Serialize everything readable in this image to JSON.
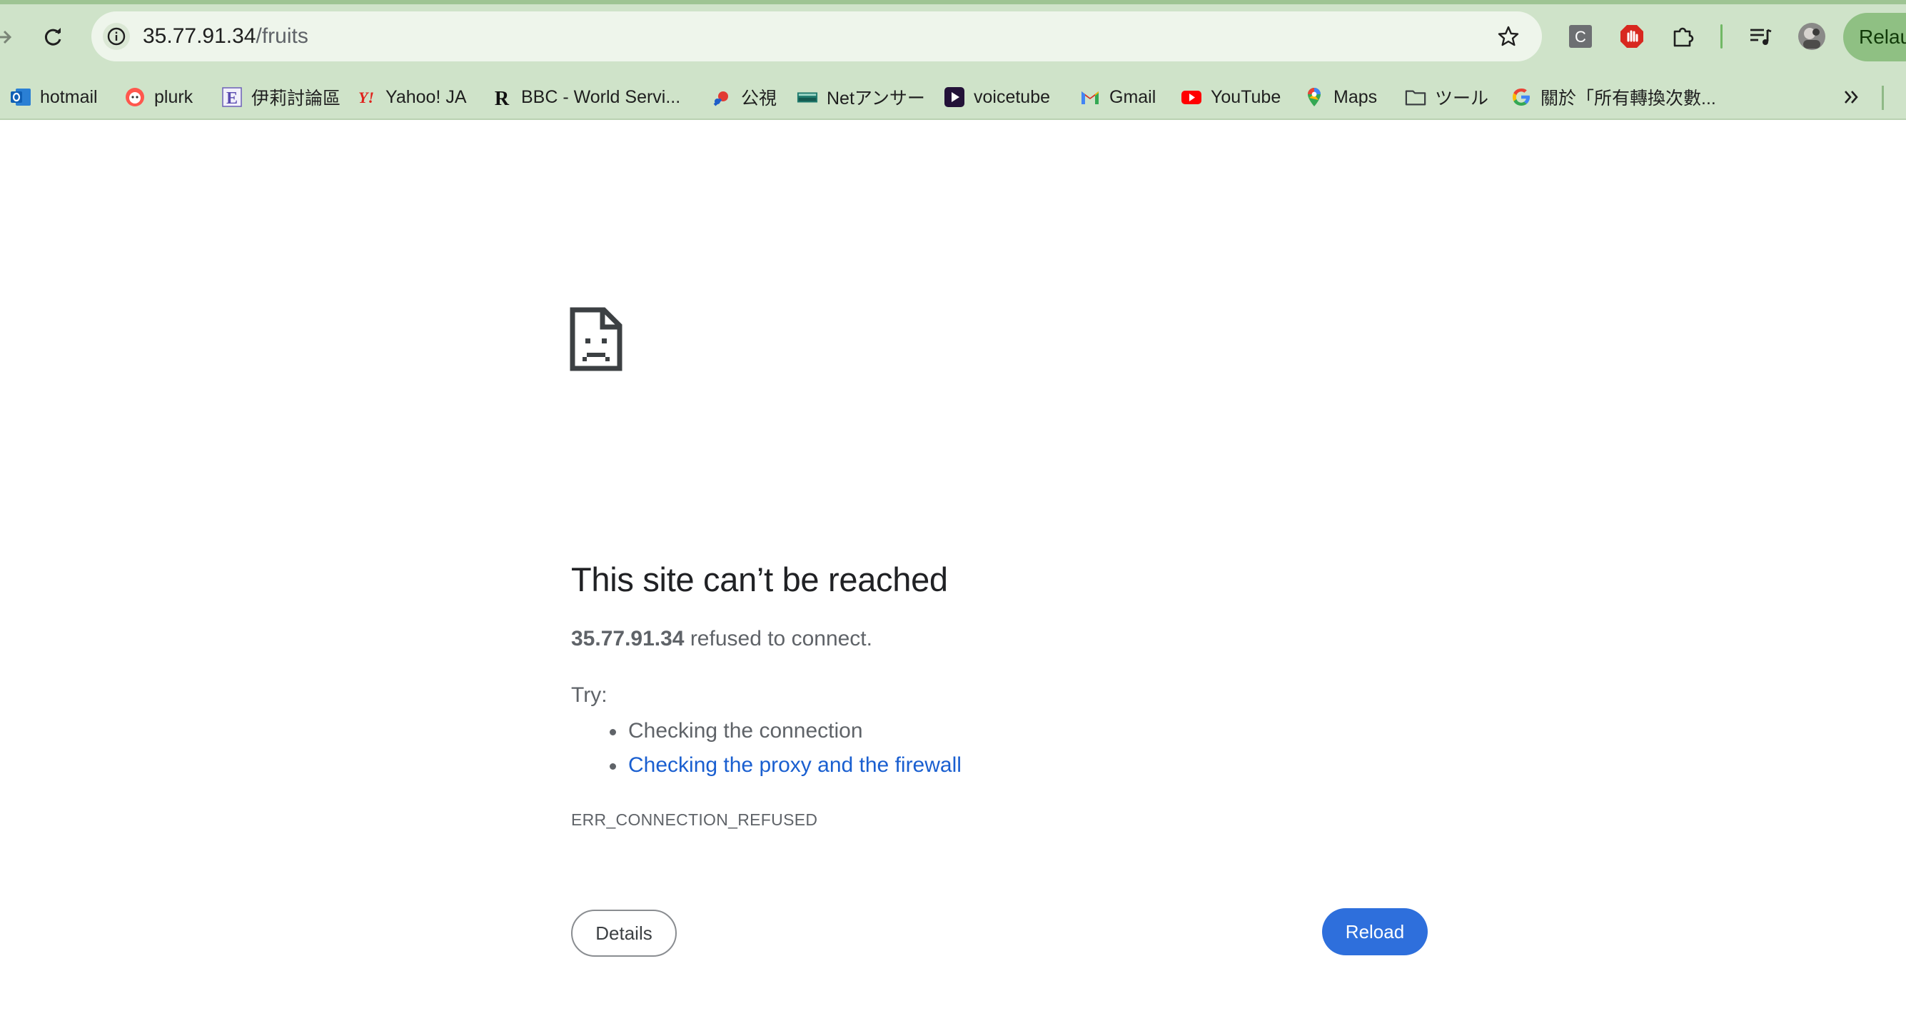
{
  "browser": {
    "url_host": "35.77.91.34",
    "url_path": "/fruits",
    "relaunch_label": "Relau",
    "colors": {
      "frame": "#cfe3c9",
      "accent": "#2e6fdc"
    }
  },
  "bookmarks": [
    {
      "label": "hotmail",
      "icon": "outlook-icon"
    },
    {
      "label": "plurk",
      "icon": "plurk-icon"
    },
    {
      "label": "伊莉討論區",
      "icon": "eyny-icon"
    },
    {
      "label": "Yahoo! JA",
      "icon": "yahoo-icon"
    },
    {
      "label": "BBC - World Servi...",
      "icon": "bbc-icon"
    },
    {
      "label": "公視",
      "icon": "pts-icon"
    },
    {
      "label": "Netアンサー",
      "icon": "saison-icon"
    },
    {
      "label": "voicetube",
      "icon": "voicetube-icon"
    },
    {
      "label": "Gmail",
      "icon": "gmail-icon"
    },
    {
      "label": "YouTube",
      "icon": "youtube-icon"
    },
    {
      "label": "Maps",
      "icon": "maps-icon"
    },
    {
      "label": "ツール",
      "icon": "folder-icon"
    },
    {
      "label": "關於「所有轉換次數...",
      "icon": "google-icon"
    }
  ],
  "error": {
    "title": "This site can’t be reached",
    "host": "35.77.91.34",
    "message": " refused to connect.",
    "try_label": "Try:",
    "suggestions": [
      {
        "text": "Checking the connection",
        "link": false
      },
      {
        "text": "Checking the proxy and the firewall",
        "link": true
      }
    ],
    "code": "ERR_CONNECTION_REFUSED",
    "details_label": "Details",
    "reload_label": "Reload"
  }
}
